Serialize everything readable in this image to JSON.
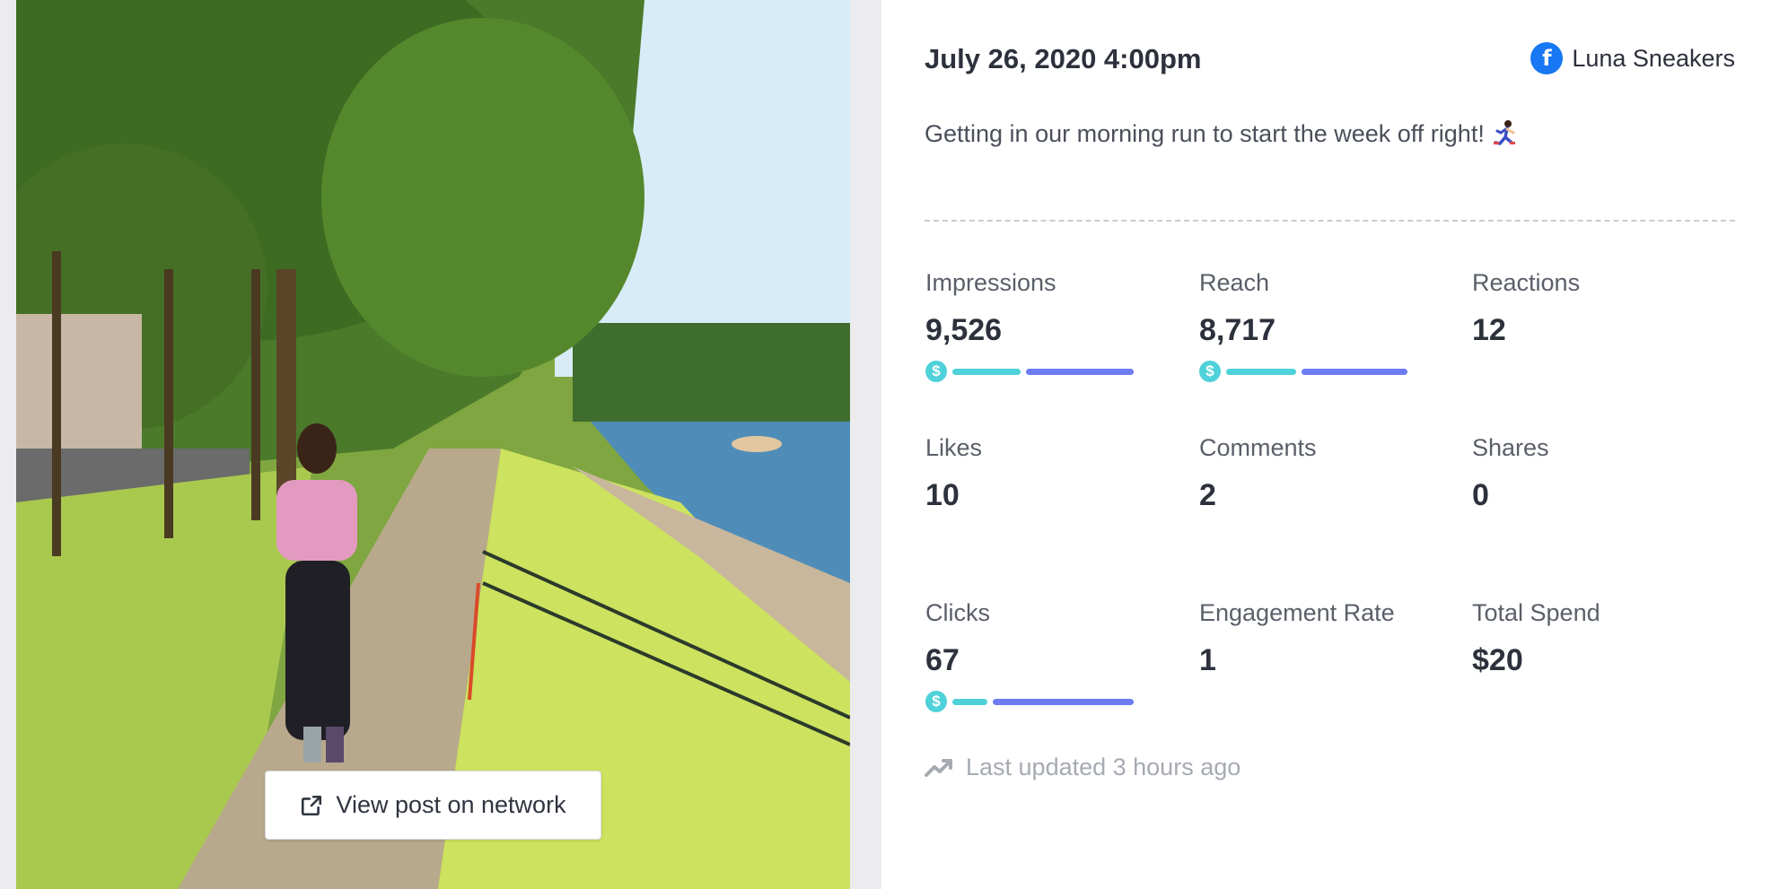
{
  "post": {
    "date": "July 26, 2020 4:00pm",
    "network_name": "Luna Sneakers",
    "network_icon": "facebook-icon",
    "caption": "Getting in our morning run to start the week off right!",
    "caption_emoji": "runner-icon",
    "view_button_label": "View post on network"
  },
  "metrics": {
    "impressions": {
      "label": "Impressions",
      "value": "9,526",
      "paid_fraction": 0.39
    },
    "reach": {
      "label": "Reach",
      "value": "8,717",
      "paid_fraction": 0.4
    },
    "reactions": {
      "label": "Reactions",
      "value": "12"
    },
    "likes": {
      "label": "Likes",
      "value": "10"
    },
    "comments": {
      "label": "Comments",
      "value": "2"
    },
    "shares": {
      "label": "Shares",
      "value": "0"
    },
    "clicks": {
      "label": "Clicks",
      "value": "67",
      "paid_fraction": 0.2
    },
    "engagement_rate": {
      "label": "Engagement Rate",
      "value": "1"
    },
    "total_spend": {
      "label": "Total Spend",
      "value": "$20"
    }
  },
  "footer": {
    "updated_text": "Last updated 3 hours ago"
  },
  "colors": {
    "paid": "#4fd1d9",
    "organic": "#6d7cf1",
    "facebook": "#1877f2"
  }
}
